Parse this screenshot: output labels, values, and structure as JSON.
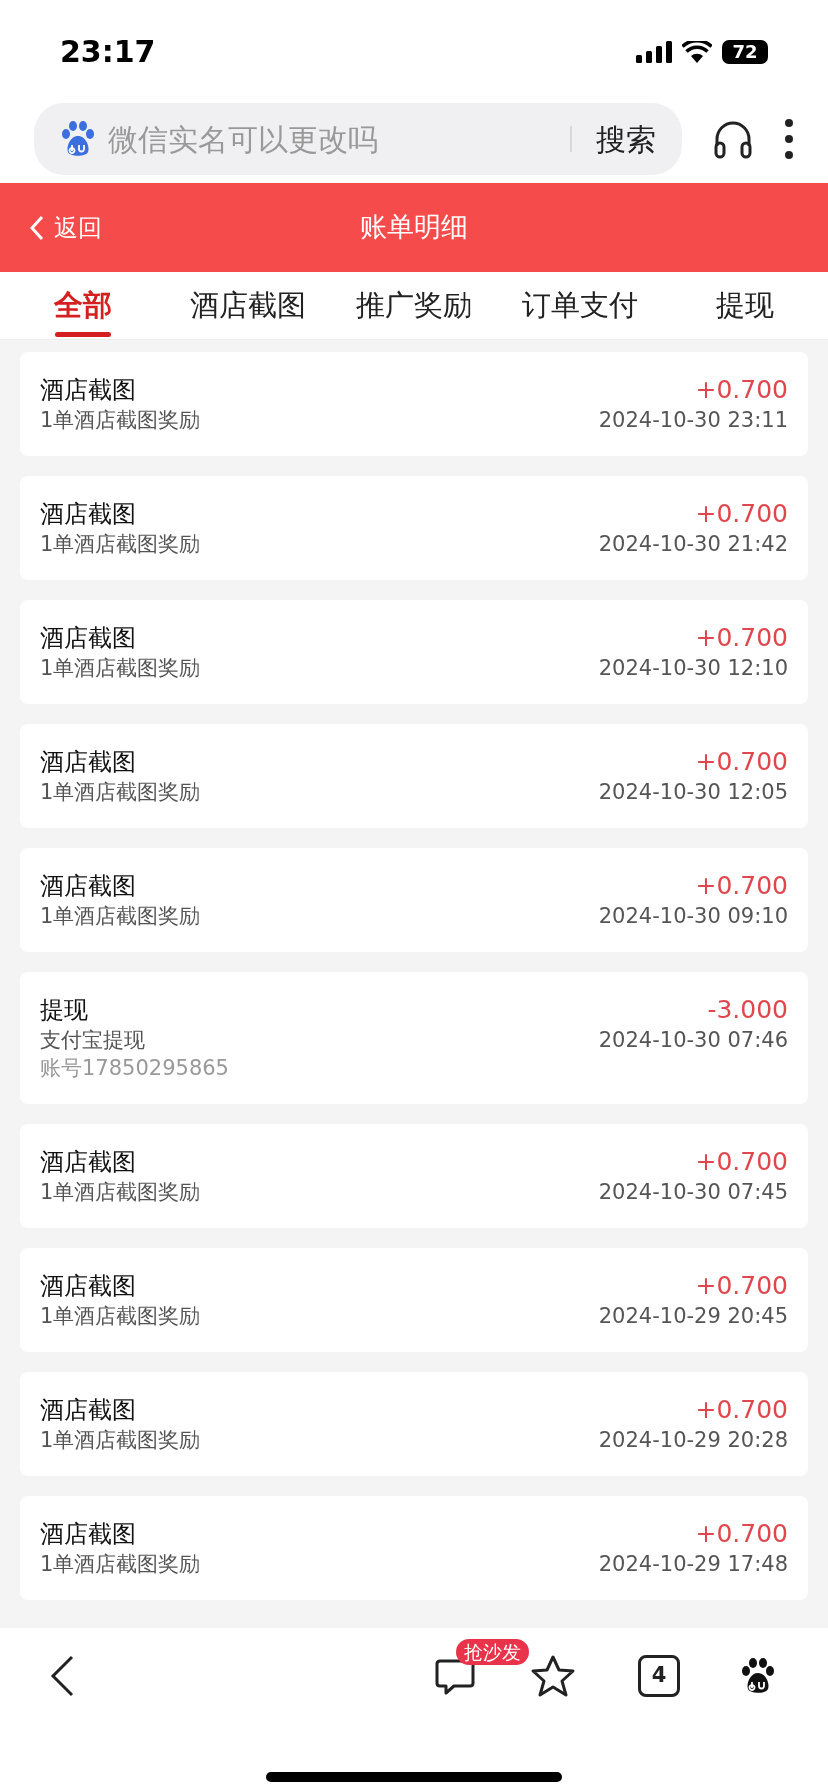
{
  "status_bar": {
    "time": "23:17",
    "battery": "72"
  },
  "search": {
    "placeholder": "微信实名可以更改吗",
    "button": "搜索"
  },
  "header": {
    "back": "返回",
    "title": "账单明细"
  },
  "tabs": [
    {
      "label": "全部",
      "selected": true
    },
    {
      "label": "酒店截图",
      "selected": false
    },
    {
      "label": "推广奖励",
      "selected": false
    },
    {
      "label": "订单支付",
      "selected": false
    },
    {
      "label": "提现",
      "selected": false
    }
  ],
  "records": [
    {
      "title": "酒店截图",
      "detail": "1单酒店截图奖励",
      "amount": "+0.700",
      "time": "2024-10-30 23:11"
    },
    {
      "title": "酒店截图",
      "detail": "1单酒店截图奖励",
      "amount": "+0.700",
      "time": "2024-10-30 21:42"
    },
    {
      "title": "酒店截图",
      "detail": "1单酒店截图奖励",
      "amount": "+0.700",
      "time": "2024-10-30 12:10"
    },
    {
      "title": "酒店截图",
      "detail": "1单酒店截图奖励",
      "amount": "+0.700",
      "time": "2024-10-30 12:05"
    },
    {
      "title": "酒店截图",
      "detail": "1单酒店截图奖励",
      "amount": "+0.700",
      "time": "2024-10-30 09:10"
    },
    {
      "title": "提现",
      "detail": "支付宝提现",
      "account": "账号17850295865",
      "amount": "-3.000",
      "time": "2024-10-30 07:46"
    },
    {
      "title": "酒店截图",
      "detail": "1单酒店截图奖励",
      "amount": "+0.700",
      "time": "2024-10-30 07:45"
    },
    {
      "title": "酒店截图",
      "detail": "1单酒店截图奖励",
      "amount": "+0.700",
      "time": "2024-10-29 20:45"
    },
    {
      "title": "酒店截图",
      "detail": "1单酒店截图奖励",
      "amount": "+0.700",
      "time": "2024-10-29 20:28"
    },
    {
      "title": "酒店截图",
      "detail": "1单酒店截图奖励",
      "amount": "+0.700",
      "time": "2024-10-29 17:48"
    }
  ],
  "bottom_bar": {
    "comment_badge": "抢沙发",
    "tab_count": "4"
  }
}
